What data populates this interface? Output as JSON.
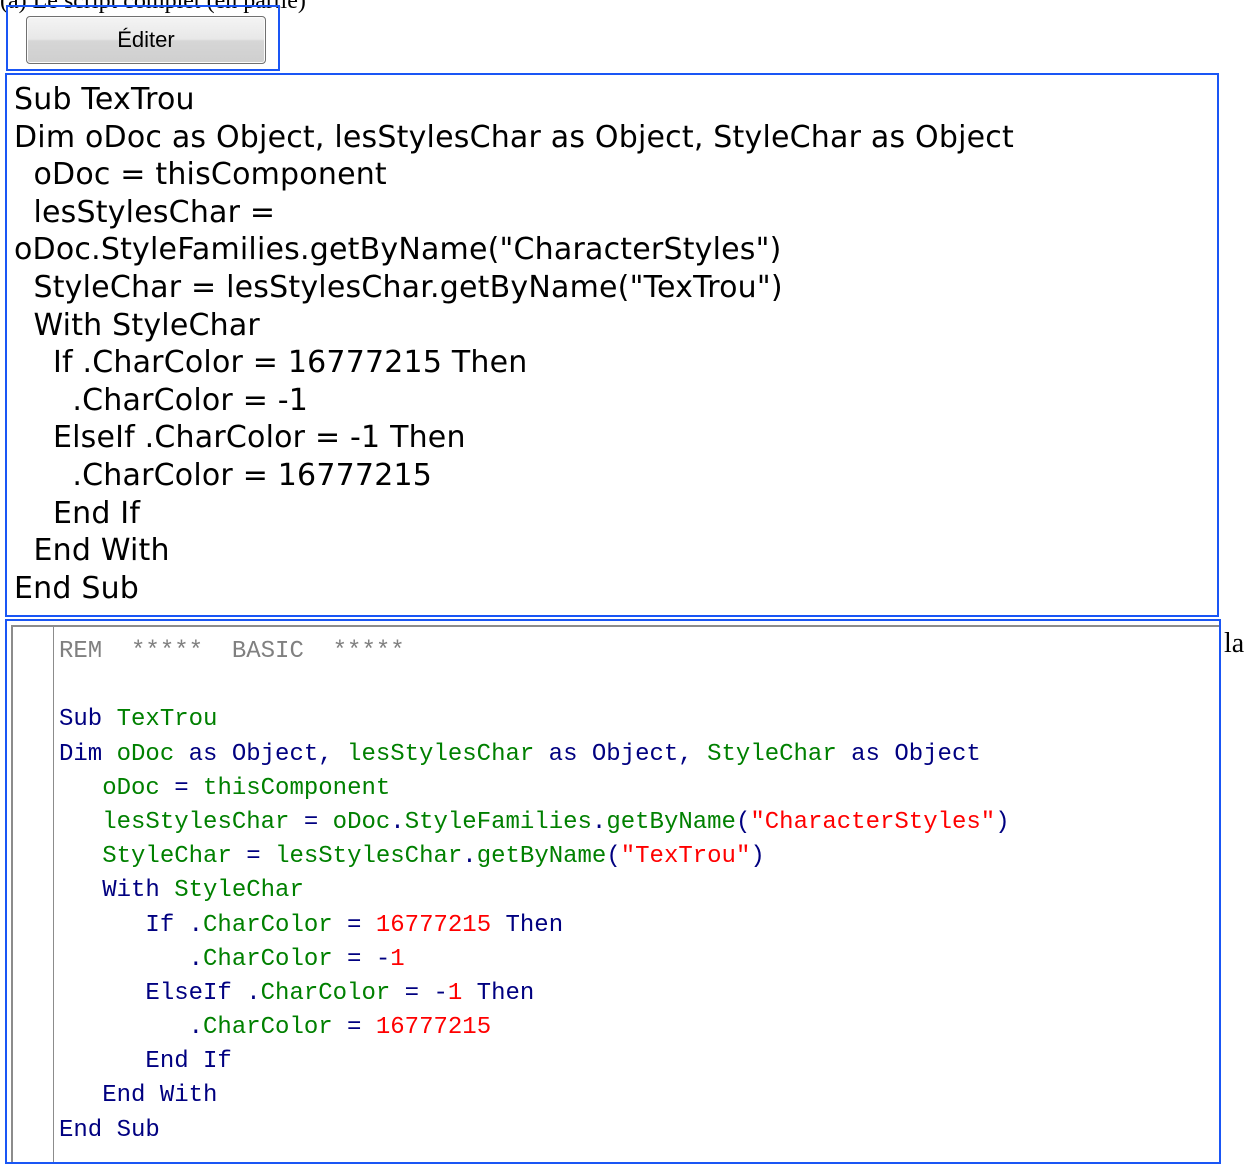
{
  "top_caption": "(a) Le script complet (en partie)",
  "edit_button_label": "Éditer",
  "text_block_lines": [
    "Sub TexTrou",
    "Dim oDoc as Object, lesStylesChar as Object, StyleChar as Object",
    "  oDoc = thisComponent",
    "  lesStylesChar =",
    "oDoc.StyleFamilies.getByName(\"CharacterStyles\")",
    "  StyleChar = lesStylesChar.getByName(\"TexTrou\")",
    "  With StyleChar",
    "    If .CharColor = 16777215 Then",
    "      .CharColor = -1",
    "    ElseIf .CharColor = -1 Then",
    "      .CharColor = 16777215",
    "    End If",
    "  End With",
    "End Sub"
  ],
  "ide_lines": [
    [
      {
        "t": "REM  *****  BASIC  *****",
        "c": "com"
      }
    ],
    [
      {
        "t": "",
        "c": "kw"
      }
    ],
    [
      {
        "t": "Sub ",
        "c": "kw"
      },
      {
        "t": "TexTrou",
        "c": "id"
      }
    ],
    [
      {
        "t": "Dim ",
        "c": "kw"
      },
      {
        "t": "oDoc",
        "c": "id"
      },
      {
        "t": " as Object, ",
        "c": "kw"
      },
      {
        "t": "lesStylesChar",
        "c": "id"
      },
      {
        "t": " as Object, ",
        "c": "kw"
      },
      {
        "t": "StyleChar",
        "c": "id"
      },
      {
        "t": " as Object",
        "c": "kw"
      }
    ],
    [
      {
        "t": "   ",
        "c": "kw"
      },
      {
        "t": "oDoc",
        "c": "id"
      },
      {
        "t": " = ",
        "c": "op"
      },
      {
        "t": "thisComponent",
        "c": "id"
      }
    ],
    [
      {
        "t": "   ",
        "c": "kw"
      },
      {
        "t": "lesStylesChar",
        "c": "id"
      },
      {
        "t": " = ",
        "c": "op"
      },
      {
        "t": "oDoc",
        "c": "id"
      },
      {
        "t": ".",
        "c": "op"
      },
      {
        "t": "StyleFamilies",
        "c": "id"
      },
      {
        "t": ".",
        "c": "op"
      },
      {
        "t": "getByName",
        "c": "id"
      },
      {
        "t": "(",
        "c": "op"
      },
      {
        "t": "\"CharacterStyles\"",
        "c": "str"
      },
      {
        "t": ")",
        "c": "op"
      }
    ],
    [
      {
        "t": "   ",
        "c": "kw"
      },
      {
        "t": "StyleChar",
        "c": "id"
      },
      {
        "t": " = ",
        "c": "op"
      },
      {
        "t": "lesStylesChar",
        "c": "id"
      },
      {
        "t": ".",
        "c": "op"
      },
      {
        "t": "getByName",
        "c": "id"
      },
      {
        "t": "(",
        "c": "op"
      },
      {
        "t": "\"TexTrou\"",
        "c": "str"
      },
      {
        "t": ")",
        "c": "op"
      }
    ],
    [
      {
        "t": "   With ",
        "c": "kw"
      },
      {
        "t": "StyleChar",
        "c": "id"
      }
    ],
    [
      {
        "t": "      If ",
        "c": "kw"
      },
      {
        "t": ".",
        "c": "op"
      },
      {
        "t": "CharColor",
        "c": "id"
      },
      {
        "t": " = ",
        "c": "op"
      },
      {
        "t": "16777215",
        "c": "num"
      },
      {
        "t": " Then",
        "c": "kw"
      }
    ],
    [
      {
        "t": "         ",
        "c": "kw"
      },
      {
        "t": ".",
        "c": "op"
      },
      {
        "t": "CharColor",
        "c": "id"
      },
      {
        "t": " = -",
        "c": "op"
      },
      {
        "t": "1",
        "c": "num"
      }
    ],
    [
      {
        "t": "      ElseIf ",
        "c": "kw"
      },
      {
        "t": ".",
        "c": "op"
      },
      {
        "t": "CharColor",
        "c": "id"
      },
      {
        "t": " = -",
        "c": "op"
      },
      {
        "t": "1",
        "c": "num"
      },
      {
        "t": " Then",
        "c": "kw"
      }
    ],
    [
      {
        "t": "         ",
        "c": "kw"
      },
      {
        "t": ".",
        "c": "op"
      },
      {
        "t": "CharColor",
        "c": "id"
      },
      {
        "t": " = ",
        "c": "op"
      },
      {
        "t": "16777215",
        "c": "num"
      }
    ],
    [
      {
        "t": "      End If",
        "c": "kw"
      }
    ],
    [
      {
        "t": "   End With",
        "c": "kw"
      }
    ],
    [
      {
        "t": "End Sub",
        "c": "kw"
      }
    ]
  ],
  "side_note": "la",
  "colors": {
    "frame_border": "#1a56f5",
    "ide_keyword": "#000080",
    "ide_identifier": "#008000",
    "ide_literal": "#ff0000",
    "ide_comment": "#808080"
  }
}
